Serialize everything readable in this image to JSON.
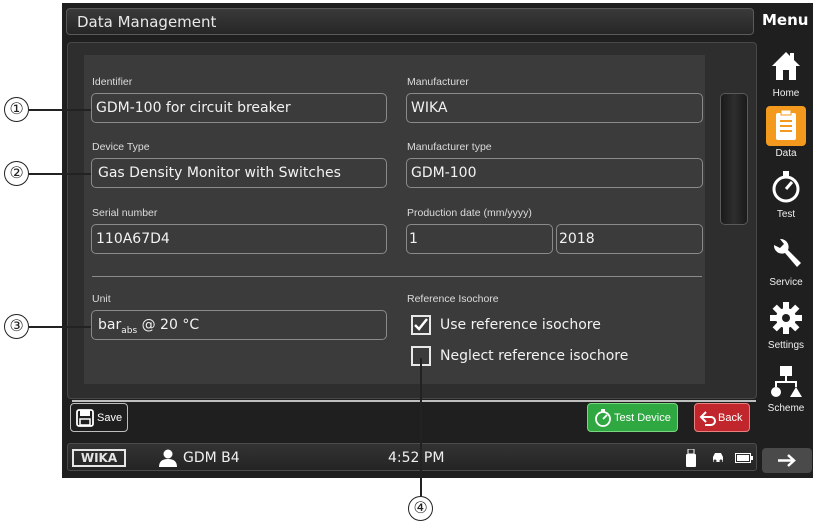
{
  "window": {
    "title": "Data Management",
    "menu_title": "Menu"
  },
  "form": {
    "identifier": {
      "label": "Identifier",
      "value": "GDM-100 for circuit breaker"
    },
    "manufacturer": {
      "label": "Manufacturer",
      "value": "WIKA"
    },
    "device_type": {
      "label": "Device Type",
      "value": "Gas Density Monitor with Switches"
    },
    "manufacturer_type": {
      "label": "Manufacturer type",
      "value": "GDM-100"
    },
    "serial_number": {
      "label": "Serial number",
      "value": "110A67D4"
    },
    "production_date": {
      "label": "Production date (mm/yyyy)",
      "month": "1",
      "year": "2018"
    },
    "unit": {
      "label": "Unit",
      "value_main": "bar",
      "value_sub": "abs",
      "value_suffix": " @ 20 °C"
    },
    "reference_isochore": {
      "label": "Reference Isochore",
      "use_label": "Use reference isochore",
      "use_checked": true,
      "neglect_label": "Neglect reference isochore",
      "neglect_checked": false
    }
  },
  "buttons": {
    "save": "Save",
    "test_device": "Test Device",
    "back": "Back"
  },
  "status_bar": {
    "logo": "WIKA",
    "user": "GDM B4",
    "time": "4:52 PM"
  },
  "menu": {
    "items": [
      {
        "label": "Home",
        "icon": "home-icon"
      },
      {
        "label": "Data",
        "icon": "clipboard-icon",
        "active": true
      },
      {
        "label": "Test",
        "icon": "gauge-icon"
      },
      {
        "label": "Service",
        "icon": "wrench-icon"
      },
      {
        "label": "Settings",
        "icon": "gear-icon"
      },
      {
        "label": "Scheme",
        "icon": "scheme-icon"
      }
    ]
  },
  "callouts": [
    "①",
    "②",
    "③",
    "④"
  ],
  "colors": {
    "active_menu": "#f39a1e",
    "test_button": "#2fa842",
    "back_button": "#c0262c"
  }
}
